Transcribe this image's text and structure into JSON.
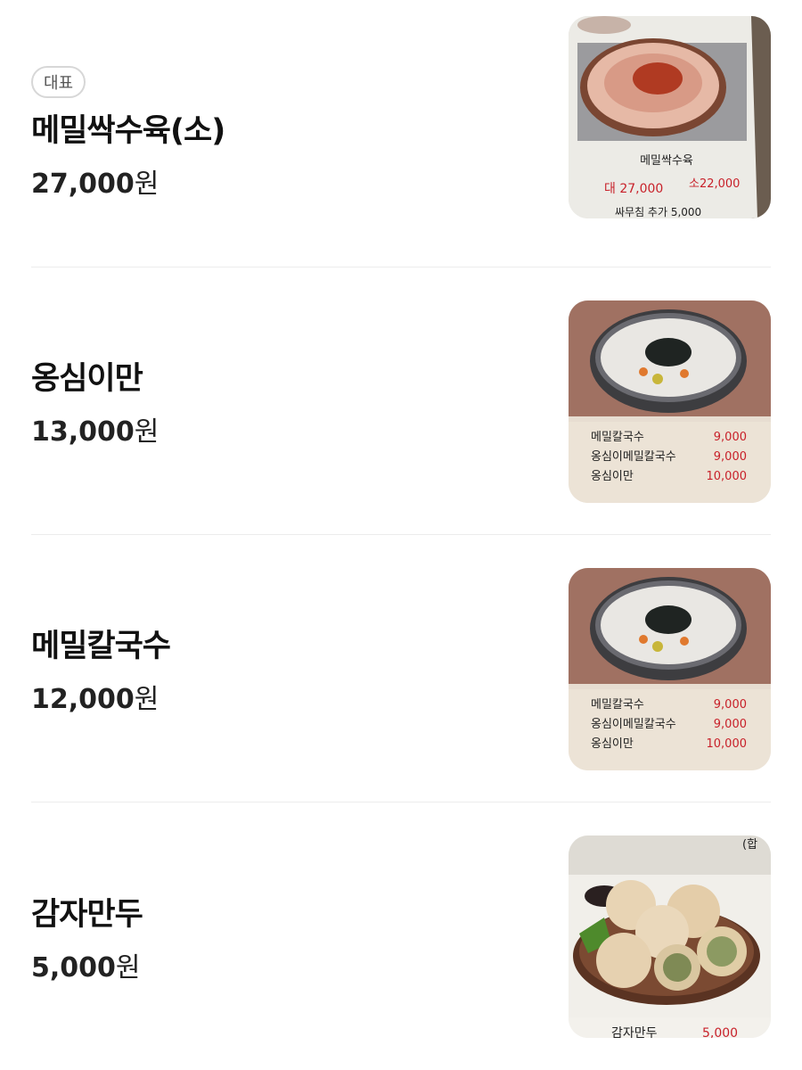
{
  "menu": [
    {
      "badge": "대표",
      "name": "메밀싹수육(소)",
      "price": "27,000",
      "currency": "원",
      "photo": {
        "icon": "boiled-pork-platter-photo",
        "board_title": "메밀싹수육",
        "board_price_large": "대 27,000",
        "board_price_small": "소22,000",
        "board_extra": "싸무침 추가 5,000"
      }
    },
    {
      "badge": "",
      "name": "옹심이만",
      "price": "13,000",
      "currency": "원",
      "photo": {
        "icon": "ongsimi-soup-bowl-photo",
        "board_lines": [
          {
            "label": "메밀칼국수",
            "price": "9,000"
          },
          {
            "label": "옹심이메밀칼국수",
            "price": "9,000"
          },
          {
            "label": "옹심이만",
            "price": "10,000"
          }
        ]
      }
    },
    {
      "badge": "",
      "name": "메밀칼국수",
      "price": "12,000",
      "currency": "원",
      "photo": {
        "icon": "ongsimi-soup-bowl-photo",
        "board_lines": [
          {
            "label": "메밀칼국수",
            "price": "9,000"
          },
          {
            "label": "옹심이메밀칼국수",
            "price": "9,000"
          },
          {
            "label": "옹심이만",
            "price": "10,000"
          }
        ]
      }
    },
    {
      "badge": "",
      "name": "감자만두",
      "price": "5,000",
      "currency": "원",
      "photo": {
        "icon": "potato-dumplings-photo",
        "board_title": "감자만두",
        "board_price": "5,000",
        "corner_text": "(합"
      }
    }
  ]
}
